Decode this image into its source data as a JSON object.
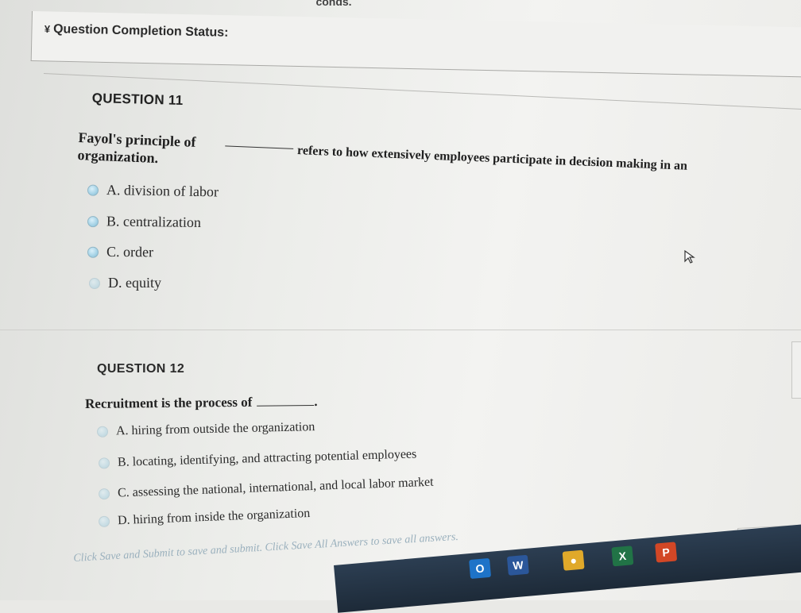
{
  "status": {
    "title": "Question Completion Status:",
    "top_clipped_text": "conds."
  },
  "q11": {
    "header": "QUESTION 11",
    "text_lead": "Fayol's principle of organization.",
    "text_rest": "refers to how extensively employees participate in decision making in an",
    "options": [
      {
        "label": "A. division of labor"
      },
      {
        "label": "B. centralization"
      },
      {
        "label": "C. order"
      },
      {
        "label": "D. equity"
      }
    ]
  },
  "q12": {
    "header": "QUESTION 12",
    "text": "Recruitment is the process of",
    "text_end": ".",
    "options": [
      {
        "label": "A. hiring from outside the organization"
      },
      {
        "label": "B. locating, identifying, and attracting potential employees"
      },
      {
        "label": "C. assessing the national, international, and local labor market"
      },
      {
        "label": "D. hiring from inside the organization"
      }
    ]
  },
  "footer": {
    "instructions": "Click Save and Submit to save and submit. Click Save All Answers to save all answers.",
    "save_all_label": "Save All Answers"
  },
  "taskbar": {
    "icons": [
      {
        "name": "outlook-icon",
        "glyph": "O",
        "color": "#1e73c8"
      },
      {
        "name": "word-icon",
        "glyph": "W",
        "color": "#2b579a"
      },
      {
        "name": "chrome-icon",
        "glyph": "●",
        "color": "#e0a92a"
      },
      {
        "name": "excel-icon",
        "glyph": "X",
        "color": "#217346"
      },
      {
        "name": "powerpoint-icon",
        "glyph": "P",
        "color": "#d24726"
      }
    ]
  }
}
